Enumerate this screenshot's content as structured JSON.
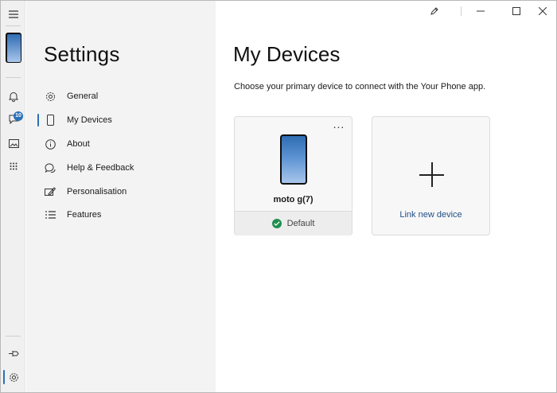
{
  "settings": {
    "title": "Settings",
    "nav": [
      {
        "label": "General",
        "icon": "gear-icon"
      },
      {
        "label": "My Devices",
        "icon": "phone-icon",
        "active": true
      },
      {
        "label": "About",
        "icon": "info-icon"
      },
      {
        "label": "Help & Feedback",
        "icon": "chat-help-icon"
      },
      {
        "label": "Personalisation",
        "icon": "paint-icon"
      },
      {
        "label": "Features",
        "icon": "list-icon"
      }
    ]
  },
  "rail": {
    "messages_badge": "10",
    "items": [
      "menu-icon",
      "phone-thumbnail",
      "bell-icon",
      "messages-icon",
      "photos-icon",
      "apps-grid-icon",
      "pin-icon",
      "settings-icon"
    ]
  },
  "main": {
    "title": "My Devices",
    "subtitle": "Choose your primary device to connect with the Your Phone app.",
    "device": {
      "name": "moto g(7)",
      "status": "Default",
      "more": "..."
    },
    "add_device": {
      "label": "Link new device"
    }
  },
  "colors": {
    "accent": "#2b6fb6",
    "success": "#1f8f4e",
    "link": "#1f4f86",
    "pane_bg": "#f3f3f3"
  }
}
